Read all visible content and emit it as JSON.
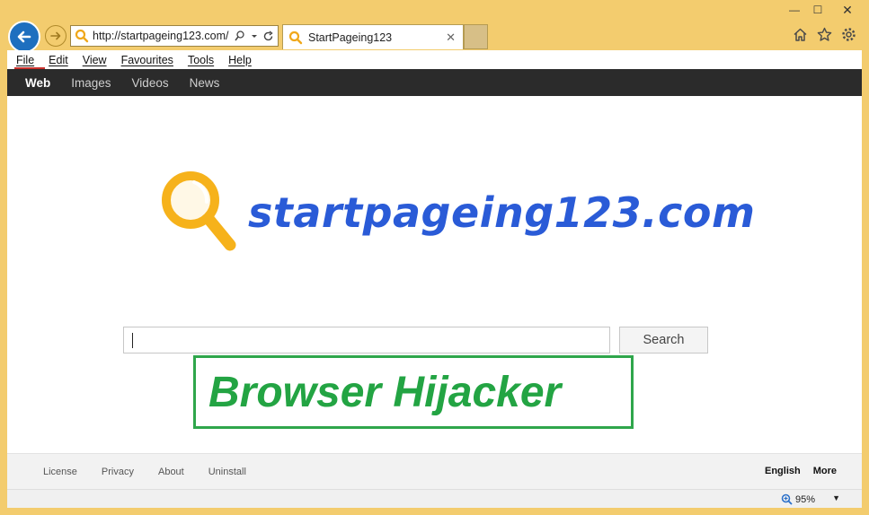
{
  "browser": {
    "address_url": "http://startpageing123.com/",
    "tab_title": "StartPageing123",
    "window_controls": {
      "minimize": "—",
      "maximize": "☐",
      "close": "✕"
    },
    "icons": {
      "home": "home-icon",
      "favorites": "star-icon",
      "settings": "gear-icon"
    }
  },
  "menu": {
    "items": [
      "File",
      "Edit",
      "View",
      "Favourites",
      "Tools",
      "Help"
    ]
  },
  "site_nav": {
    "items": [
      "Web",
      "Images",
      "Videos",
      "News"
    ],
    "active": "Web"
  },
  "logo": {
    "text": "startpageing123.com"
  },
  "search": {
    "input_value": "",
    "button_label": "Search"
  },
  "overlay": {
    "label": "Browser Hijacker"
  },
  "footer": {
    "links": [
      "License",
      "Privacy",
      "About",
      "Uninstall"
    ],
    "language": "English",
    "more": "More"
  },
  "statusbar": {
    "zoom": "95%"
  },
  "colors": {
    "frame": "#f3cc6e",
    "brand_blue": "#2a5bd7",
    "logo_yellow": "#f6b21b",
    "overlay_green": "#23a443",
    "nav_bg": "#2b2b2b"
  }
}
